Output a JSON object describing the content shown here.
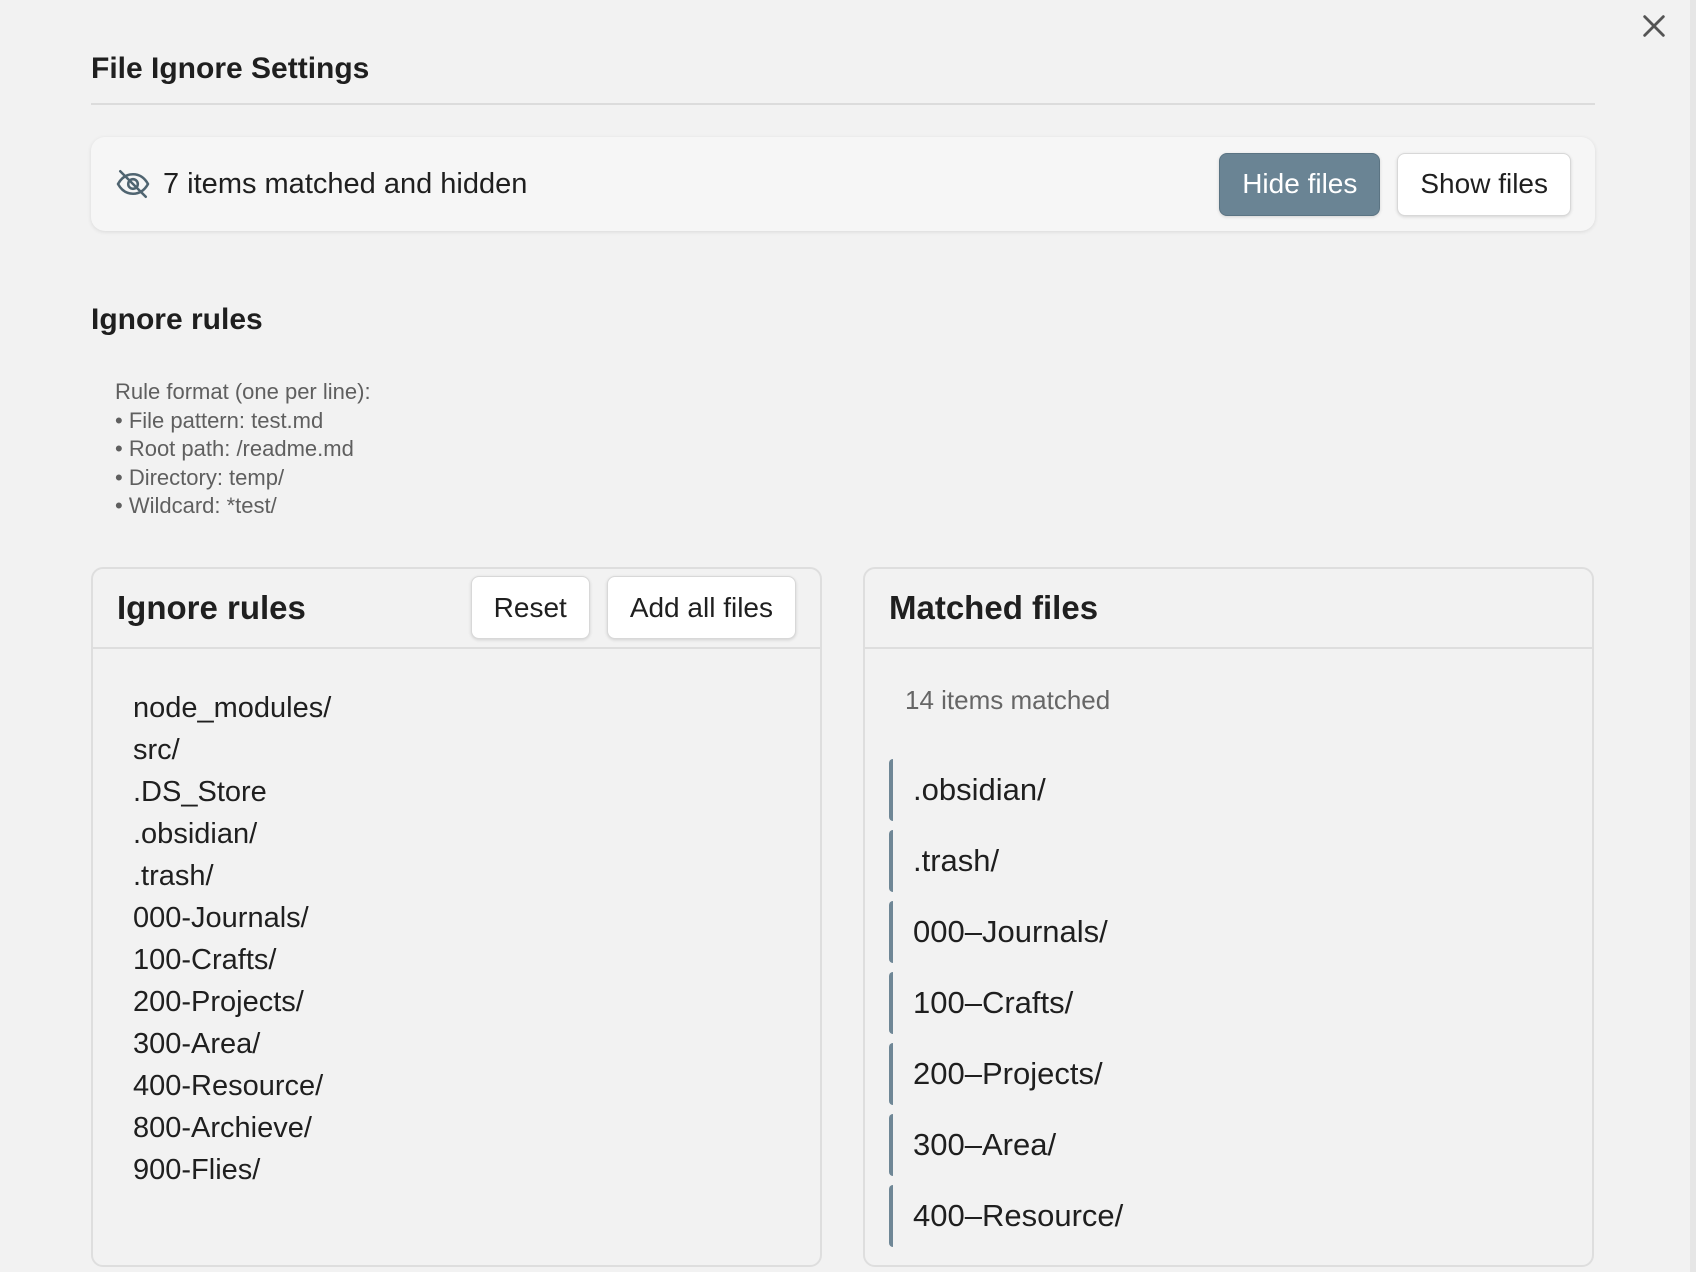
{
  "modal": {
    "title": "File Ignore Settings"
  },
  "status": {
    "icon": "eye-off-icon",
    "text": "7 items matched and hidden",
    "hide_label": "Hide files",
    "show_label": "Show files",
    "active_button": "hide"
  },
  "ignore_section": {
    "heading": "Ignore rules",
    "help": [
      "Rule format (one per line):",
      "• File pattern: test.md",
      "• Root path: /readme.md",
      "• Directory: temp/",
      "• Wildcard: *test/"
    ]
  },
  "rules_panel": {
    "title": "Ignore rules",
    "reset_label": "Reset",
    "add_all_label": "Add all files",
    "rules": [
      "node_modules/",
      "src/",
      ".DS_Store",
      ".obsidian/",
      ".trash/",
      "000-Journals/",
      "100-Crafts/",
      "200-Projects/",
      "300-Area/",
      "400-Resource/",
      "800-Archieve/",
      "900-Flies/"
    ]
  },
  "matched_panel": {
    "title": "Matched files",
    "count_text": "14 items matched",
    "items": [
      ".obsidian/",
      ".trash/",
      "000–Journals/",
      "100–Crafts/",
      "200–Projects/",
      "300–Area/",
      "400–Resource/"
    ]
  },
  "colors": {
    "background": "#f2f2f2",
    "primary_button": "#6a8494",
    "match_accent": "#6f8796"
  }
}
